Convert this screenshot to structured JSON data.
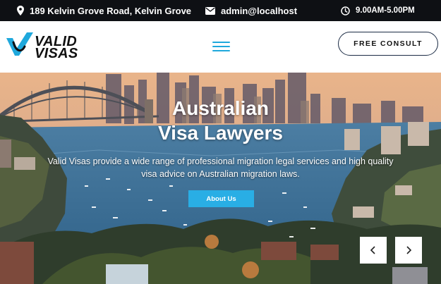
{
  "topbar": {
    "address": "189 Kelvin Grove Road, Kelvin Grove",
    "email": "admin@localhost",
    "hours": "9.00AM-5.00PM"
  },
  "header": {
    "logo_line1": "VALID",
    "logo_line2": "VISAS",
    "consult_label": "FREE CONSULT"
  },
  "hero": {
    "title_line1": "Australian",
    "title_line2": "Visa Lawyers",
    "desc_line1": "Valid Visas provide a wide range of professional migration legal services and high quality",
    "desc_line2": "visa advice on Australian migration laws.",
    "cta_label": "About Us"
  },
  "icons": {
    "address": "map-pin-icon",
    "email": "envelope-icon",
    "hours": "clock-icon",
    "menu": "hamburger-menu-icon",
    "prev": "chevron-left-icon",
    "next": "chevron-right-icon"
  },
  "colors": {
    "topbar_bg": "#0e1014",
    "accent": "#29aee5",
    "logo_blue": "#1fa8dc"
  }
}
